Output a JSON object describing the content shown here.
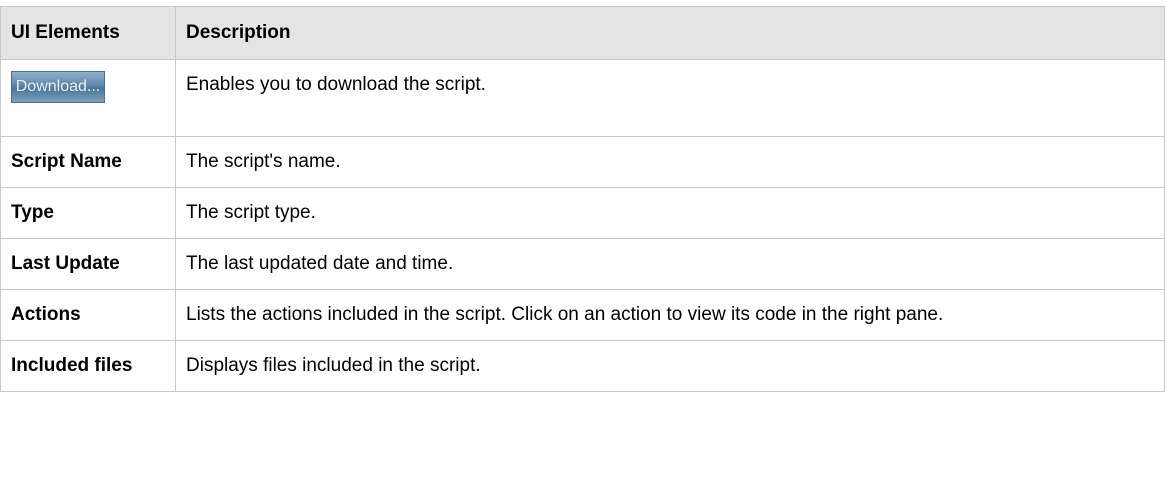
{
  "table": {
    "headers": {
      "ui_elements": "UI Elements",
      "description": "Description"
    },
    "download_row": {
      "button_label": "Download...",
      "description": "Enables you to download the script."
    },
    "rows": [
      {
        "element": "Script Name",
        "description": "The script's name."
      },
      {
        "element": "Type",
        "description": "The script type."
      },
      {
        "element": "Last Update",
        "description": "The last updated date and time."
      },
      {
        "element": "Actions",
        "description": "Lists the actions included in the script. Click on an action to view its code in the right pane."
      },
      {
        "element": "Included files",
        "description": "Displays files included in the script."
      }
    ]
  }
}
